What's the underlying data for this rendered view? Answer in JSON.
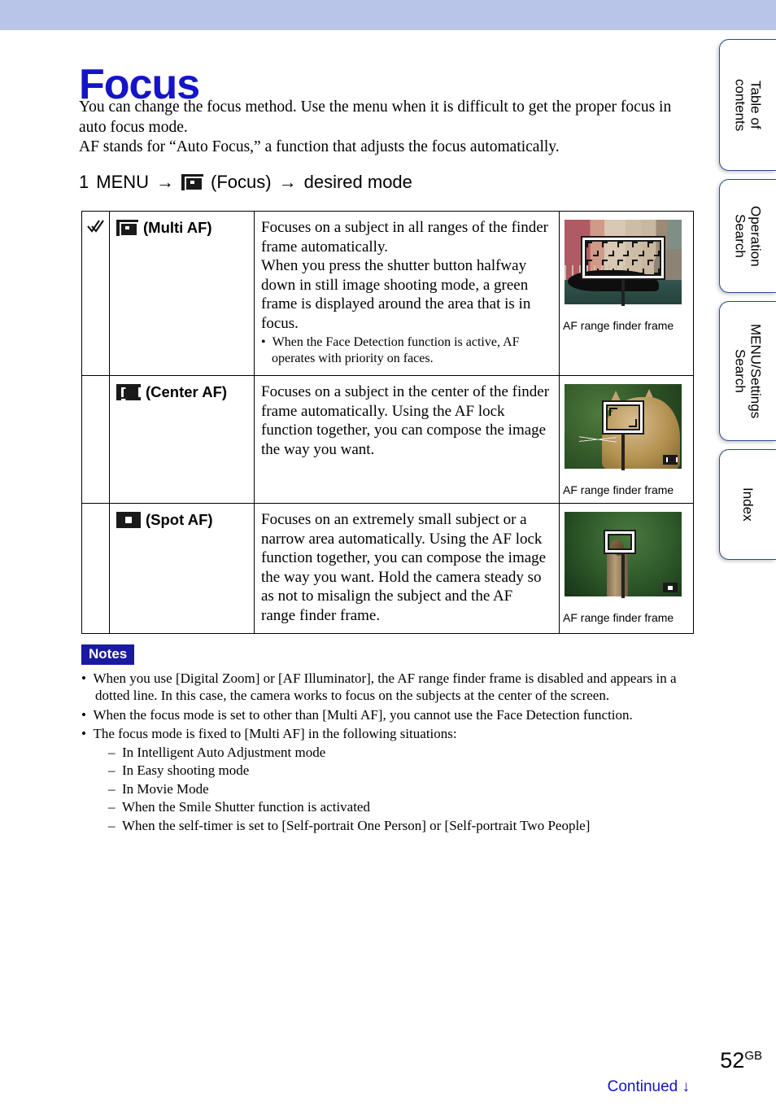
{
  "header": {
    "band_color": "#b8c4e8"
  },
  "sidebar": {
    "tabs": [
      {
        "label": "Table of\ncontents",
        "name": "table-of-contents"
      },
      {
        "label": "Operation\nSearch",
        "name": "operation-search"
      },
      {
        "label": "MENU/Settings\nSearch",
        "name": "menu-settings-search"
      },
      {
        "label": "Index",
        "name": "index"
      }
    ]
  },
  "page": {
    "title": "Focus",
    "title_color": "#1414c8",
    "intro": "You can change the focus method. Use the menu when it is difficult to get the proper focus in auto focus mode.\nAF stands for “Auto Focus,” a function that adjusts the focus automatically.",
    "step": {
      "number": "1",
      "menu_label": "MENU",
      "arrow": "→",
      "icon_label": "(Focus)",
      "icon_name": "multi-af-icon",
      "arrow2": "→",
      "result": "desired mode"
    }
  },
  "table": {
    "rows": [
      {
        "default_marker": "✓✓",
        "is_default": true,
        "icon": "multi-af-icon",
        "mode": "(Multi AF)",
        "description": "Focuses on a subject in all ranges of the finder frame automatically.\nWhen you press the shutter button halfway down in still image shooting mode, a green frame is displayed around the area that is in focus.",
        "bullet": "When the Face Detection function is active, AF operates with priority on faces.",
        "figure_caption": "AF range finder frame",
        "figure_kind": "venice-multi-af"
      },
      {
        "default_marker": "",
        "is_default": false,
        "icon": "center-af-icon",
        "mode": "(Center AF)",
        "description": "Focuses on a subject in the center of the finder frame automatically. Using the AF lock function together, you can compose the image the way you want.",
        "bullet": "",
        "figure_caption": "AF range finder frame",
        "figure_kind": "cat-center-af"
      },
      {
        "default_marker": "",
        "is_default": false,
        "icon": "spot-af-icon",
        "mode": "(Spot AF)",
        "description": "Focuses on an extremely small subject or a narrow area automatically. Using the AF lock function together, you can compose the image the way you want. Hold the camera steady so as not to misalign the subject and the AF range finder frame.",
        "bullet": "",
        "figure_caption": "AF range finder frame",
        "figure_kind": "bird-spot-af"
      }
    ]
  },
  "notes": {
    "badge": "Notes",
    "badge_color": "#1a1aa0",
    "items": [
      "When you use [Digital Zoom] or [AF Illuminator], the AF range finder frame is disabled and appears in a dotted line. In this case, the camera works to focus on the subjects at the center of the screen.",
      "When the focus mode is set to other than [Multi AF], you cannot use the Face Detection function.",
      "The focus mode is fixed to [Multi AF] in the following situations:"
    ],
    "sub_items": [
      "In Intelligent Auto Adjustment mode",
      "In Easy shooting mode",
      "In Movie Mode",
      "When the Smile Shutter function is activated",
      "When the self-timer is set to [Self-portrait One Person] or [Self-portrait Two People]"
    ]
  },
  "footer": {
    "page_number": "52",
    "page_suffix": "GB",
    "continued": "Continued ↓",
    "continued_color": "#1414c8"
  }
}
